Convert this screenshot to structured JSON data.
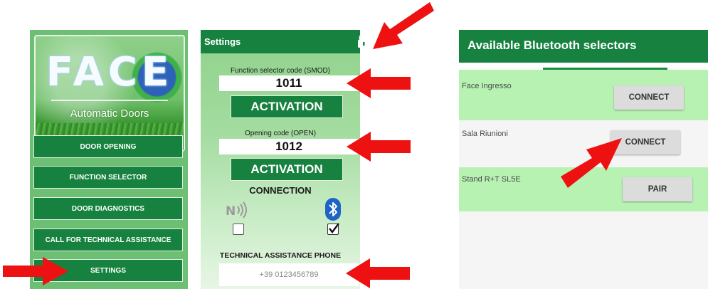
{
  "menu_screen": {
    "logo": {
      "title": "FACE",
      "subtitle": "Automatic Doors"
    },
    "buttons": [
      "DOOR OPENING",
      "FUNCTION SELECTOR",
      "DOOR DIAGNOSTICS",
      "CALL FOR TECHNICAL ASSISTANCE",
      "SETTINGS"
    ]
  },
  "settings_screen": {
    "title": "Settings",
    "lock_icon": "lock-icon",
    "function_code": {
      "label": "Function selector code (SMOD)",
      "value": "1011",
      "button": "ACTIVATION"
    },
    "opening_code": {
      "label": "Opening code (OPEN)",
      "value": "1012",
      "button": "ACTIVATION"
    },
    "connection": {
      "label": "CONNECTION",
      "nfc": {
        "icon": "nfc-icon",
        "checked": false
      },
      "bluetooth": {
        "icon": "bluetooth-icon",
        "checked": true
      }
    },
    "phone": {
      "label": "TECHNICAL ASSISTANCE PHONE",
      "value": "+39 0123456789"
    }
  },
  "bluetooth_screen": {
    "title": "Available Bluetooth selectors",
    "devices": [
      {
        "name": "Face Ingresso",
        "action": "CONNECT",
        "highlighted": true
      },
      {
        "name": "Sala Riunioni",
        "action": "CONNECT",
        "highlighted": false
      },
      {
        "name": "Stand R+T SL5E",
        "action": "PAIR",
        "highlighted": true
      }
    ]
  },
  "colors": {
    "primary_green": "#17823f",
    "panel_green": "#6cbf73",
    "highlight_row": "#b7f2b3",
    "arrow_red": "#ee1111"
  }
}
